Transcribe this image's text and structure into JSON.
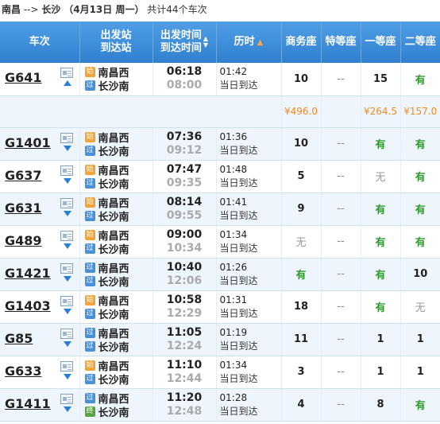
{
  "header": {
    "route_from": "南昌",
    "arrow": "-->",
    "route_to": "长沙",
    "date": "（4月13日  周一）",
    "count": "共计44个车次"
  },
  "columns": {
    "train": "车次",
    "station_l1": "出发站",
    "station_l2": "到达站",
    "time_l1": "出发时间",
    "time_l2": "到达时间",
    "duration": "历时",
    "business": "商务座",
    "premium": "特等座",
    "first": "一等座",
    "second": "二等座"
  },
  "trains": [
    {
      "no": "G641",
      "expanded": true,
      "dep_badge": "始",
      "dep_station": "南昌西",
      "arr_badge": "过",
      "arr_station": "长沙南",
      "dep_time": "06:18",
      "arr_time": "08:00",
      "duration": "01:42",
      "note": "当日到达",
      "business": "10",
      "premium": "--",
      "first": "15",
      "second": "有"
    },
    {
      "no": "G1401",
      "expanded": false,
      "dep_badge": "始",
      "dep_station": "南昌西",
      "arr_badge": "过",
      "arr_station": "长沙南",
      "dep_time": "07:36",
      "arr_time": "09:12",
      "duration": "01:36",
      "note": "当日到达",
      "business": "10",
      "premium": "--",
      "first": "有",
      "second": "有"
    },
    {
      "no": "G637",
      "expanded": false,
      "dep_badge": "始",
      "dep_station": "南昌西",
      "arr_badge": "过",
      "arr_station": "长沙南",
      "dep_time": "07:47",
      "arr_time": "09:35",
      "duration": "01:48",
      "note": "当日到达",
      "business": "5",
      "premium": "--",
      "first": "无",
      "second": "有"
    },
    {
      "no": "G631",
      "expanded": false,
      "dep_badge": "始",
      "dep_station": "南昌西",
      "arr_badge": "过",
      "arr_station": "长沙南",
      "dep_time": "08:14",
      "arr_time": "09:55",
      "duration": "01:41",
      "note": "当日到达",
      "business": "9",
      "premium": "--",
      "first": "有",
      "second": "有"
    },
    {
      "no": "G489",
      "expanded": false,
      "dep_badge": "始",
      "dep_station": "南昌西",
      "arr_badge": "过",
      "arr_station": "长沙南",
      "dep_time": "09:00",
      "arr_time": "10:34",
      "duration": "01:34",
      "note": "当日到达",
      "business": "无",
      "premium": "--",
      "first": "有",
      "second": "有"
    },
    {
      "no": "G1421",
      "expanded": false,
      "dep_badge": "过",
      "dep_station": "南昌西",
      "arr_badge": "过",
      "arr_station": "长沙南",
      "dep_time": "10:40",
      "arr_time": "12:06",
      "duration": "01:26",
      "note": "当日到达",
      "business": "有",
      "premium": "--",
      "first": "有",
      "second": "10"
    },
    {
      "no": "G1403",
      "expanded": false,
      "dep_badge": "始",
      "dep_station": "南昌西",
      "arr_badge": "过",
      "arr_station": "长沙南",
      "dep_time": "10:58",
      "arr_time": "12:29",
      "duration": "01:31",
      "note": "当日到达",
      "business": "18",
      "premium": "--",
      "first": "有",
      "second": "无"
    },
    {
      "no": "G85",
      "expanded": false,
      "dep_badge": "过",
      "dep_station": "南昌西",
      "arr_badge": "过",
      "arr_station": "长沙南",
      "dep_time": "11:05",
      "arr_time": "12:24",
      "duration": "01:19",
      "note": "当日到达",
      "business": "11",
      "premium": "--",
      "first": "1",
      "second": "1"
    },
    {
      "no": "G633",
      "expanded": false,
      "dep_badge": "始",
      "dep_station": "南昌西",
      "arr_badge": "过",
      "arr_station": "长沙南",
      "dep_time": "11:10",
      "arr_time": "12:44",
      "duration": "01:34",
      "note": "当日到达",
      "business": "3",
      "premium": "--",
      "first": "1",
      "second": "1"
    },
    {
      "no": "G1411",
      "expanded": false,
      "dep_badge": "过",
      "dep_station": "南昌西",
      "arr_badge": "终",
      "arr_station": "长沙南",
      "dep_time": "11:20",
      "arr_time": "12:48",
      "duration": "01:28",
      "note": "当日到达",
      "business": "4",
      "premium": "--",
      "first": "8",
      "second": "有"
    }
  ],
  "price_row": {
    "business": "¥496.0",
    "premium": "",
    "first": "¥264.5",
    "second": "¥157.0"
  },
  "icons": {
    "detail": "document-icon",
    "expand": "triangle-down-icon",
    "collapse": "triangle-up-icon"
  },
  "colors": {
    "header_bg": "#3a8ad9",
    "available": "#2e9a2e",
    "price": "#f08a24",
    "badge_start": "#f0a43a",
    "badge_pass": "#4a90d9",
    "badge_end": "#5aa541"
  }
}
